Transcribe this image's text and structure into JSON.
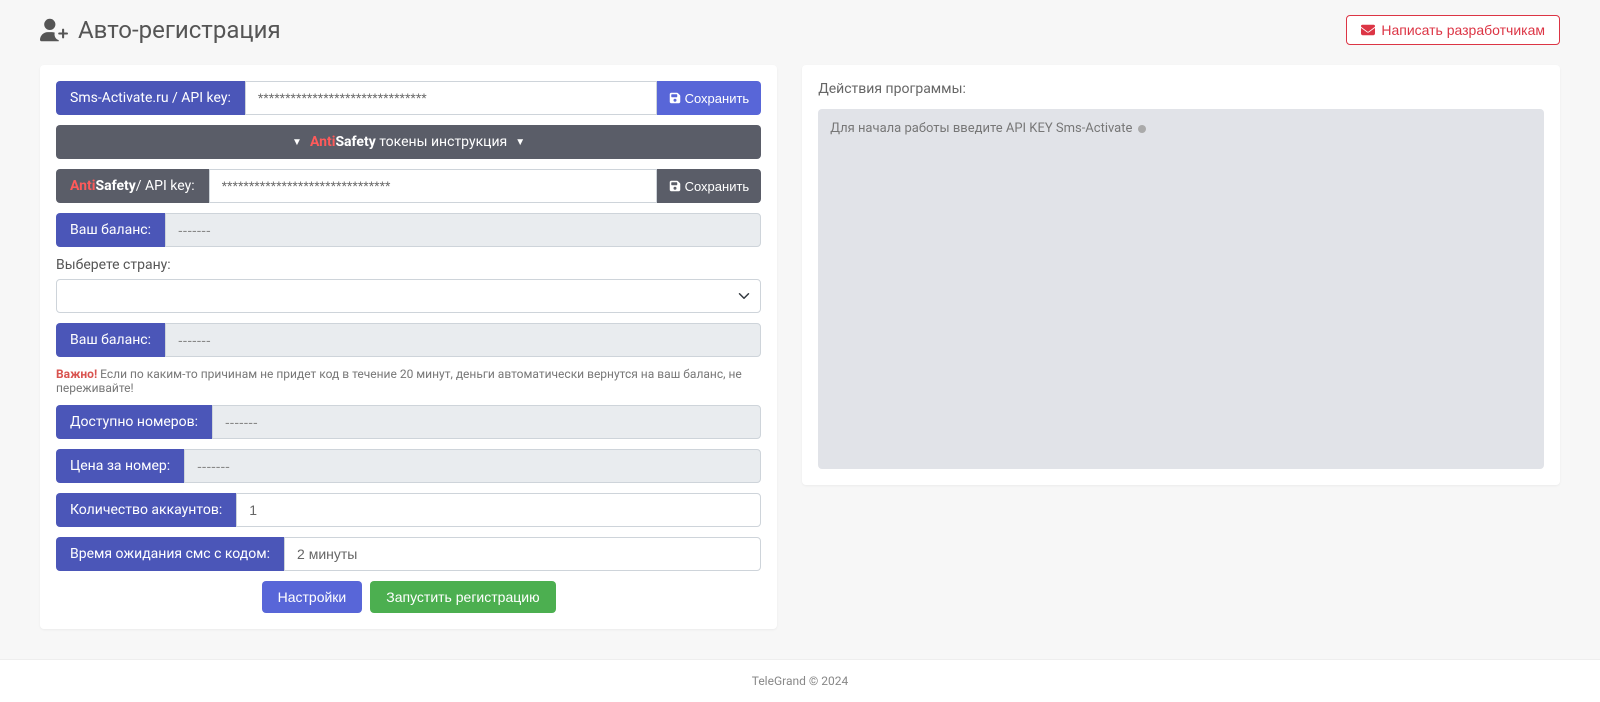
{
  "header": {
    "title": "Авто-регистрация",
    "contact_devs": "Написать разработчикам"
  },
  "sms_activate": {
    "label": "Sms-Activate.ru / API key:",
    "value": "*******************************",
    "save": "Сохранить"
  },
  "collapse": {
    "tokens_instruction": "токены инструкция"
  },
  "antisafety": {
    "label_suffix": " / API key:",
    "value": "*******************************",
    "save": "Сохранить"
  },
  "balance1": {
    "label": "Ваш баланс:",
    "value": "-------"
  },
  "country": {
    "label": "Выберете страну:"
  },
  "balance2": {
    "label": "Ваш баланс:",
    "value": "-------"
  },
  "warning": {
    "prefix": "Важно!",
    "text": " Если по каким-то причинам не придет код в течение 20 минут, деньги автоматически вернутся на ваш баланс, не переживайте!"
  },
  "available": {
    "label": "Доступно номеров:",
    "value": "-------"
  },
  "price": {
    "label": "Цена за номер:",
    "value": "-------"
  },
  "accounts": {
    "label": "Количество аккаунтов:",
    "value": "1"
  },
  "sms_wait": {
    "label": "Время ожидания смс с кодом:",
    "value": "2 минуты"
  },
  "actions": {
    "settings": "Настройки",
    "start": "Запустить регистрацию"
  },
  "log": {
    "title": "Действия программы:",
    "message": "Для начала работы введите API KEY Sms-Activate"
  },
  "footer": "TeleGrand © 2024"
}
